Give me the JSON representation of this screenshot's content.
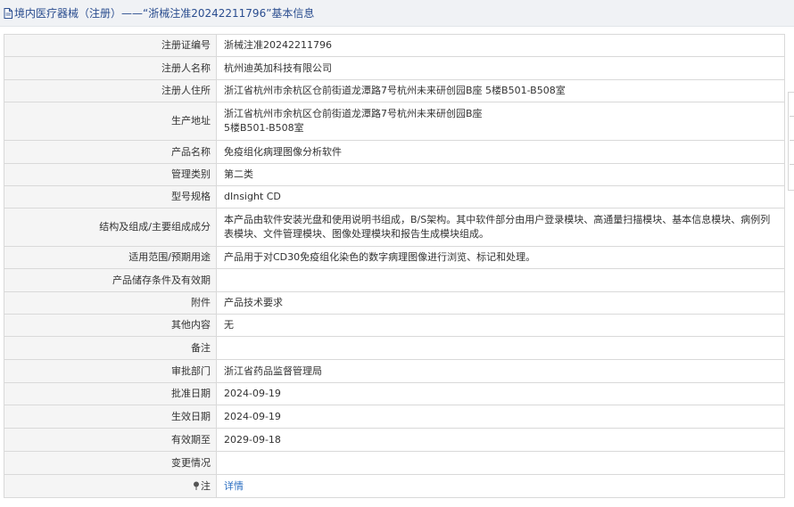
{
  "header": {
    "title": "境内医疗器械（注册）——“浙械注准20242211796”基本信息",
    "icon": "document-icon"
  },
  "rows": [
    {
      "label": "注册证编号",
      "value": "浙械注准20242211796"
    },
    {
      "label": "注册人名称",
      "value": "杭州迪英加科技有限公司"
    },
    {
      "label": "注册人住所",
      "value": "浙江省杭州市余杭区仓前街道龙潭路7号杭州未来研创园B座 5楼B501-B508室"
    },
    {
      "label": "生产地址",
      "value": "浙江省杭州市余杭区仓前街道龙潭路7号杭州未来研创园B座\n5楼B501-B508室"
    },
    {
      "label": "产品名称",
      "value": "免疫组化病理图像分析软件"
    },
    {
      "label": "管理类别",
      "value": "第二类"
    },
    {
      "label": "型号规格",
      "value": "dInsight CD"
    },
    {
      "label": "结构及组成/主要组成成分",
      "value": "本产品由软件安装光盘和使用说明书组成，B/S架构。其中软件部分由用户登录模块、高通量扫描模块、基本信息模块、病例列表模块、文件管理模块、图像处理模块和报告生成模块组成。"
    },
    {
      "label": "适用范围/预期用途",
      "value": "产品用于对CD30免疫组化染色的数字病理图像进行浏览、标记和处理。"
    },
    {
      "label": "产品储存条件及有效期",
      "value": ""
    },
    {
      "label": "附件",
      "value": "产品技术要求"
    },
    {
      "label": "其他内容",
      "value": "无"
    },
    {
      "label": "备注",
      "value": ""
    },
    {
      "label": "审批部门",
      "value": "浙江省药品监督管理局"
    },
    {
      "label": "批准日期",
      "value": "2024-09-19"
    },
    {
      "label": "生效日期",
      "value": "2024-09-19"
    },
    {
      "label": "有效期至",
      "value": "2029-09-18"
    },
    {
      "label": "变更情况",
      "value": ""
    }
  ],
  "note_row": {
    "label": "注",
    "icon": "pin-icon",
    "link": "详情"
  },
  "colors": {
    "title_bg": "#f0f2f5",
    "title_text": "#2a4d8f",
    "label_bg": "#f5f5f5",
    "border": "#d9d9d9",
    "link": "#2a6ec1"
  }
}
